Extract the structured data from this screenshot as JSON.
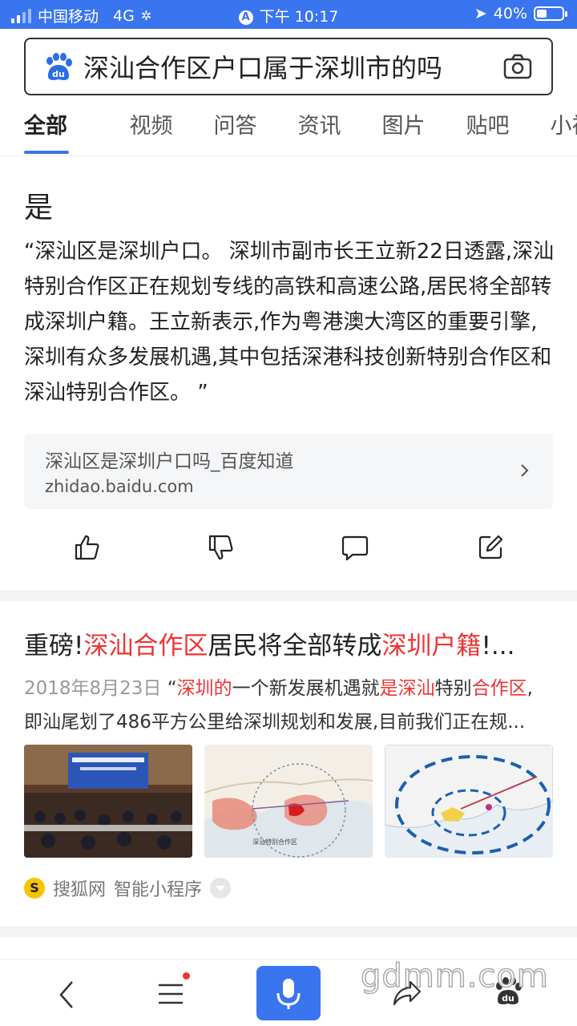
{
  "status_bar": {
    "carrier": "中国移动",
    "network": "4G",
    "time": "下午 10:17",
    "battery_percent": "40%",
    "battery_level": 0.4
  },
  "search": {
    "query": "深汕合作区户口属于深圳市的吗"
  },
  "tabs": [
    "全部",
    "视频",
    "问答",
    "资讯",
    "图片",
    "贴吧",
    "小视"
  ],
  "answer": {
    "title": "是",
    "body": "“深汕区是深圳户口。 深圳市副市长王立新22日透露,深汕特别合作区正在规划专线的高铁和高速公路,居民将全部转成深圳户籍。王立新表示,作为粤港澳大湾区的重要引擎,深圳有众多发展机遇,其中包括深港科技创新特别合作区和深汕特别合作区。 ”",
    "source_title": "深汕区是深圳户口吗_百度知道",
    "source_url": "zhidao.baidu.com"
  },
  "result2": {
    "title_parts": [
      "重磅!",
      "深汕合作区",
      "居民将全部转成",
      "深圳户籍",
      "!..."
    ],
    "date": "2018年8月23日",
    "snippet_parts": [
      "“",
      "深圳的",
      "一个新发展机遇就",
      "是深汕",
      "特别",
      "合作区",
      ","
    ],
    "snippet_line2": "即汕尾划了486平方公里给深圳规划和发展,目前我们正在规...",
    "source_name": "搜狐网",
    "source_tag": "智能小程序",
    "thumb2_caption": "深汕特别合作区"
  },
  "watermark": "gdmm.com",
  "colors": {
    "accent": "#3a75f0",
    "highlight": "#e33333"
  }
}
